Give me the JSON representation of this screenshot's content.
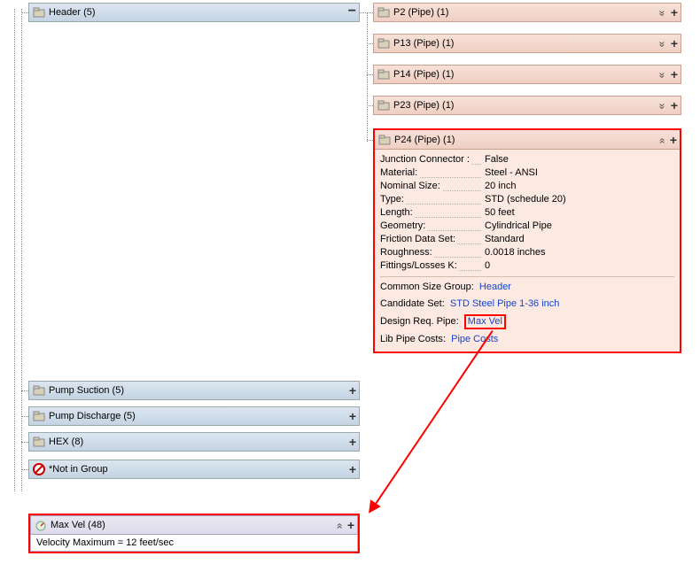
{
  "left_groups": [
    {
      "label": "Header (5)",
      "control": "minus"
    },
    {
      "label": "Pump Suction (5)",
      "control": "plus"
    },
    {
      "label": "Pump Discharge (5)",
      "control": "plus"
    },
    {
      "label": "HEX (8)",
      "control": "plus"
    },
    {
      "label": "*Not in Group",
      "control": "plus",
      "not_in_group": true
    }
  ],
  "pipes": [
    {
      "label": "P2 (Pipe) (1)"
    },
    {
      "label": "P13 (Pipe) (1)"
    },
    {
      "label": "P14 (Pipe) (1)"
    },
    {
      "label": "P23 (Pipe) (1)"
    }
  ],
  "expanded_pipe": {
    "label": "P24 (Pipe) (1)",
    "props": [
      {
        "k": "Junction Connector :",
        "v": "False"
      },
      {
        "k": "Material:",
        "v": "Steel - ANSI"
      },
      {
        "k": "Nominal Size:",
        "v": "20 inch"
      },
      {
        "k": "Type:",
        "v": "STD (schedule 20)"
      },
      {
        "k": "Length:",
        "v": "50 feet"
      },
      {
        "k": "Geometry:",
        "v": "Cylindrical Pipe"
      },
      {
        "k": "Friction Data Set:",
        "v": "Standard"
      },
      {
        "k": "Roughness:",
        "v": "0.0018 inches"
      },
      {
        "k": "Fittings/Losses K:",
        "v": "0"
      }
    ],
    "links": {
      "csg_label": "Common Size Group:",
      "csg_value": "Header",
      "cand_label": "Candidate Set:",
      "cand_value": "STD Steel Pipe 1-36 inch",
      "dreq_label": "Design Req. Pipe:",
      "dreq_value": "Max Vel",
      "lib_label": "Lib Pipe Costs:",
      "lib_value": "Pipe Costs"
    }
  },
  "maxvel": {
    "label": "Max Vel (48)",
    "body": "Velocity Maximum = 12 feet/sec"
  }
}
